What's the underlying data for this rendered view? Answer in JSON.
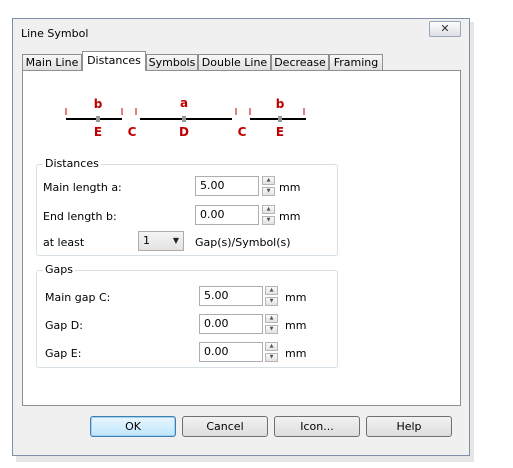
{
  "window": {
    "title": "Line Symbol",
    "close_icon": "close-icon"
  },
  "tabs": [
    {
      "label": "Main Line"
    },
    {
      "label": "Distances"
    },
    {
      "label": "Symbols"
    },
    {
      "label": "Double Line"
    },
    {
      "label": "Decrease"
    },
    {
      "label": "Framing"
    }
  ],
  "diagram": {
    "upper_labels": [
      "b",
      "a",
      "b"
    ],
    "lower_labels": [
      "E",
      "C",
      "D",
      "C",
      "E"
    ],
    "color": "#c00000"
  },
  "distances": {
    "title": "Distances",
    "main_length": {
      "label": "Main length a:",
      "value": "5.00",
      "unit": "mm"
    },
    "end_length": {
      "label": "End length b:",
      "value": "0.00",
      "unit": "mm"
    },
    "at_least": {
      "label": "at least",
      "value": "1",
      "suffix": "Gap(s)/Symbol(s)"
    }
  },
  "gaps": {
    "title": "Gaps",
    "main_gap": {
      "label": "Main gap C:",
      "value": "5.00",
      "unit": "mm"
    },
    "gap_d": {
      "label": "Gap D:",
      "value": "0.00",
      "unit": "mm"
    },
    "gap_e": {
      "label": "Gap E:",
      "value": "0.00",
      "unit": "mm"
    }
  },
  "buttons": {
    "ok": "OK",
    "cancel": "Cancel",
    "icon": "Icon...",
    "help": "Help"
  }
}
